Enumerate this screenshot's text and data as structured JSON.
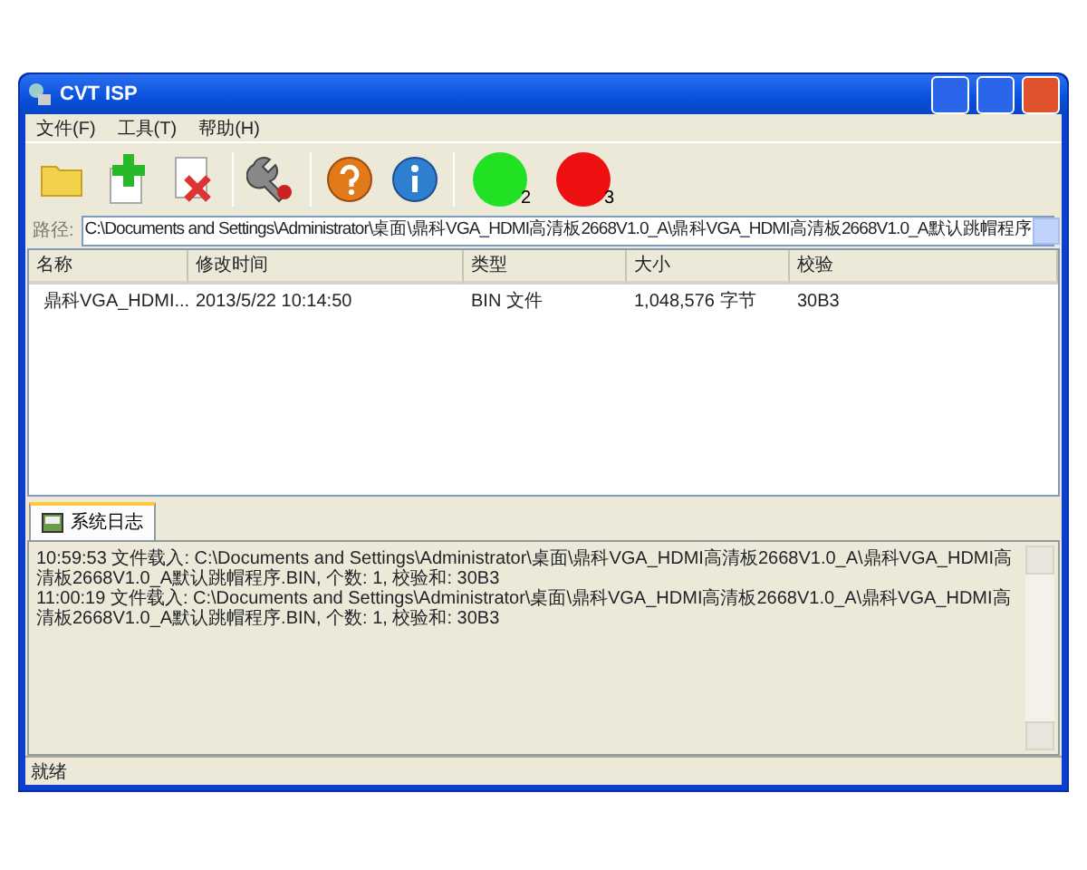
{
  "window": {
    "title": "CVT ISP"
  },
  "menu": [
    "文件(F)",
    "工具(T)",
    "帮助(H)"
  ],
  "indicators": [
    {
      "label": "2",
      "color": "#22e022"
    },
    {
      "label": "3",
      "color": "#ee1010"
    }
  ],
  "path": {
    "label": "路径:",
    "value": "C:\\Documents and Settings\\Administrator\\桌面\\鼎科VGA_HDMI高清板2668V1.0_A\\鼎科VGA_HDMI高清板2668V1.0_A默认跳帽程序"
  },
  "table": {
    "columns": [
      "名称",
      "修改时间",
      "类型",
      "大小",
      "校验"
    ],
    "rows": [
      [
        "鼎科VGA_HDMI...",
        "2013/5/22 10:14:50",
        "BIN 文件",
        "1,048,576 字节",
        "30B3"
      ]
    ]
  },
  "tabs": [
    {
      "label": "系统日志",
      "selected": true
    }
  ],
  "log": [
    "10:59:53 文件载入: C:\\Documents and Settings\\Administrator\\桌面\\鼎科VGA_HDMI高清板2668V1.0_A\\鼎科VGA_HDMI高清板2668V1.0_A默认跳帽程序.BIN, 个数: 1, 校验和: 30B3",
    "11:00:19 文件载入: C:\\Documents and Settings\\Administrator\\桌面\\鼎科VGA_HDMI高清板2668V1.0_A\\鼎科VGA_HDMI高清板2668V1.0_A默认跳帽程序.BIN, 个数: 1, 校验和: 30B3"
  ],
  "status_bar": "就绪"
}
